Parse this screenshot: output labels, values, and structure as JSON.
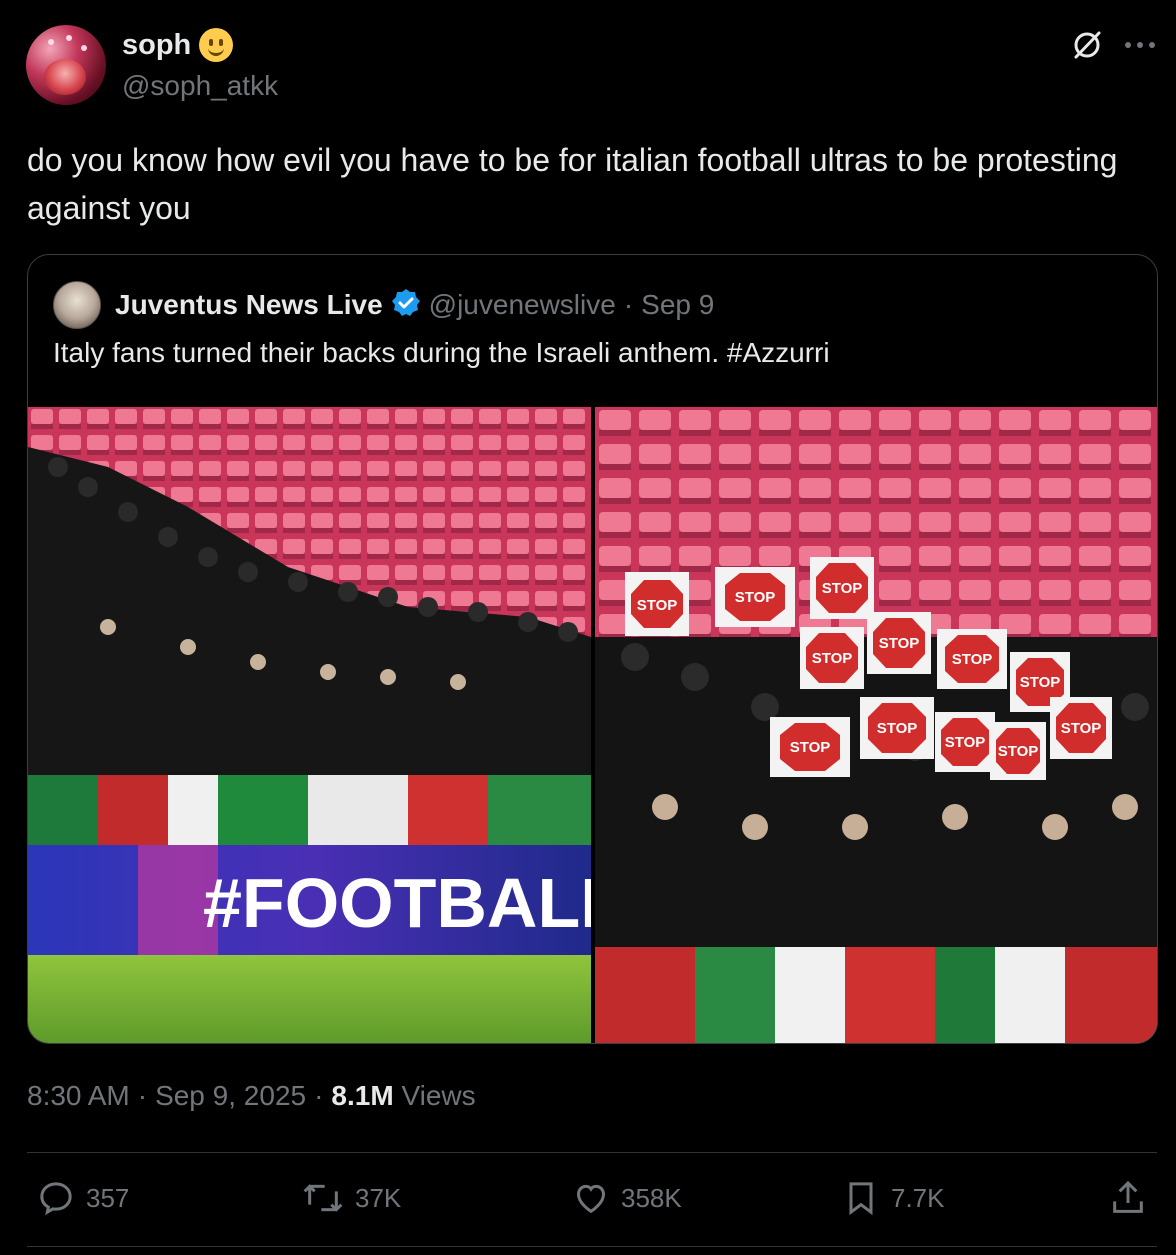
{
  "author": {
    "display_name": "soph",
    "handle": "@soph_atkk",
    "emoji_icon": "slightly-smiling-face-icon"
  },
  "tweet": {
    "text": "do you know how evil you have to be for italian football ultras to be protesting against you"
  },
  "quoted": {
    "display_name": "Juventus News Live",
    "handle": "@juvenewslive",
    "separator": "·",
    "date": "Sep 9",
    "text": "Italy fans turned their backs during the Israeli anthem. #Azzurri",
    "verified_color": "#1d9bf0",
    "board_text": "#FOOTBALL",
    "sign_text": "STOP"
  },
  "meta": {
    "time": "8:30 AM",
    "sep1": "·",
    "date": "Sep 9, 2025",
    "sep2": "·",
    "views_count": "8.1M",
    "views_label": "Views"
  },
  "actions": {
    "replies": "357",
    "reposts": "37K",
    "likes": "358K",
    "bookmarks": "7.7K"
  },
  "colors": {
    "background": "#000000",
    "text": "#e7e9ea",
    "muted": "#71767b",
    "border": "#2f3336"
  }
}
